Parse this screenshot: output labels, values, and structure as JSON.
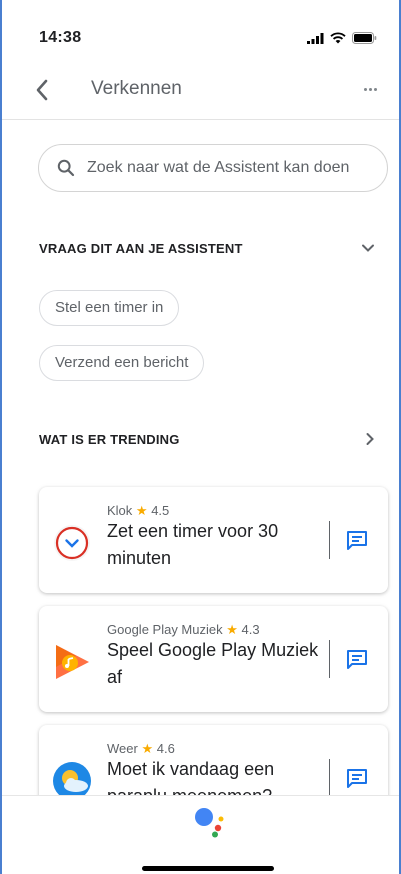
{
  "status_bar": {
    "time": "14:38"
  },
  "header": {
    "title": "Verkennen"
  },
  "search": {
    "placeholder": "Zoek naar wat de Assistent kan doen"
  },
  "ask_section": {
    "heading": "VRAAG DIT AAN JE ASSISTENT",
    "chips": [
      "Stel een timer in",
      "Verzend een bericht"
    ]
  },
  "trending_section": {
    "heading": "WAT IS ER TRENDING",
    "cards": [
      {
        "app": "Klok",
        "rating": "4.5",
        "text": "Zet een timer voor 30 minuten",
        "icon": "clock-icon"
      },
      {
        "app": "Google Play Muziek",
        "rating": "4.3",
        "text": "Speel Google Play Muziek af",
        "icon": "play-music-icon"
      },
      {
        "app": "Weer",
        "rating": "4.6",
        "text": "Moet ik vandaag een paraplu meenemen?",
        "icon": "weather-icon"
      }
    ]
  },
  "colors": {
    "accent_blue": "#1a73e8",
    "star": "#f9ab00"
  }
}
